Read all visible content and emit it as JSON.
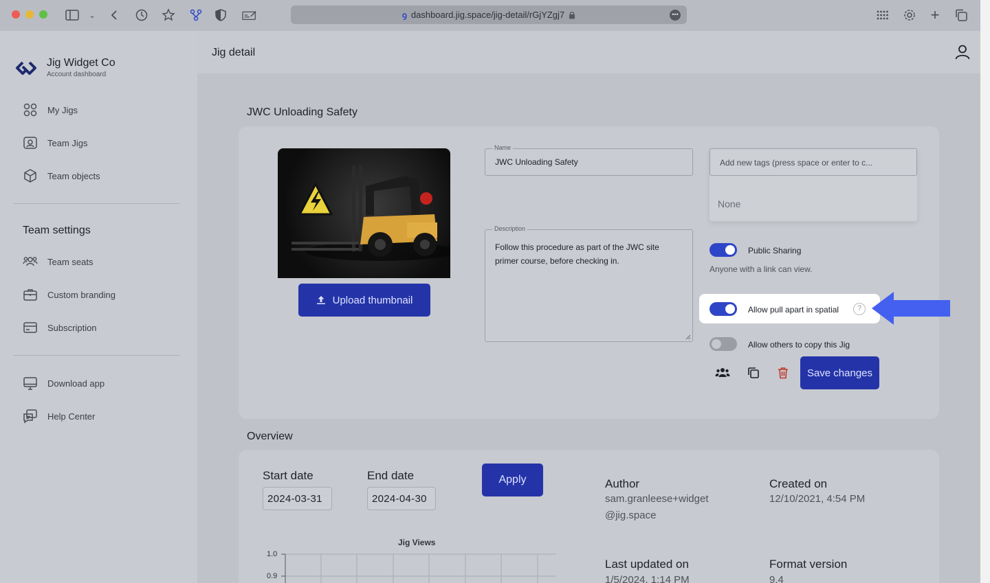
{
  "browser": {
    "url": "dashboard.jig.space/jig-detail/rGjYZgj7",
    "colors": {
      "red": "#ec5b55",
      "yellow": "#e6b83a",
      "green": "#5fc046"
    }
  },
  "sidebar": {
    "brand_name": "Jig Widget Co",
    "brand_sub": "Account dashboard",
    "items": [
      {
        "label": "My Jigs",
        "icon": "grid-icon"
      },
      {
        "label": "Team Jigs",
        "icon": "team-jigs-icon"
      },
      {
        "label": "Team objects",
        "icon": "cube-icon"
      }
    ],
    "section_title": "Team settings",
    "settings_items": [
      {
        "label": "Team seats",
        "icon": "users-icon"
      },
      {
        "label": "Custom branding",
        "icon": "briefcase-icon"
      },
      {
        "label": "Subscription",
        "icon": "card-icon"
      }
    ],
    "footer_items": [
      {
        "label": "Download app",
        "icon": "monitor-icon"
      },
      {
        "label": "Help Center",
        "icon": "help-icon"
      }
    ]
  },
  "header": {
    "title": "Jig detail"
  },
  "detail": {
    "heading": "JWC Unloading Safety",
    "upload_label": "Upload thumbnail",
    "name_label": "Name",
    "name_value": "JWC Unloading Safety",
    "description_label": "Description",
    "description_value": "Follow this procedure as part of the JWC site primer course, before checking in.",
    "tags_placeholder": "Add new tags (press space or enter to c...",
    "tags_empty": "None",
    "public_sharing_label": "Public Sharing",
    "public_sharing_on": true,
    "public_sharing_hint": "Anyone with a link can view.",
    "pull_apart_label": "Allow pull apart in spatial",
    "pull_apart_on": true,
    "pull_apart_help": "?",
    "copy_label": "Allow others to copy this Jig",
    "copy_on": false,
    "save_label": "Save changes"
  },
  "overview": {
    "heading": "Overview",
    "start_label": "Start date",
    "start_value": "2024-03-31",
    "end_label": "End date",
    "end_value": "2024-04-30",
    "apply_label": "Apply",
    "author_label": "Author",
    "author_value": "sam.granleese+widget@jig.space",
    "created_label": "Created on",
    "created_value": "12/10/2021, 4:54 PM",
    "updated_label": "Last updated on",
    "updated_value": "1/5/2024, 1:14 PM",
    "format_label": "Format version",
    "format_value": "9.4"
  },
  "chart_data": {
    "type": "line",
    "title": "Jig Views",
    "yticks": [
      "1.0",
      "0.9"
    ],
    "series": []
  }
}
